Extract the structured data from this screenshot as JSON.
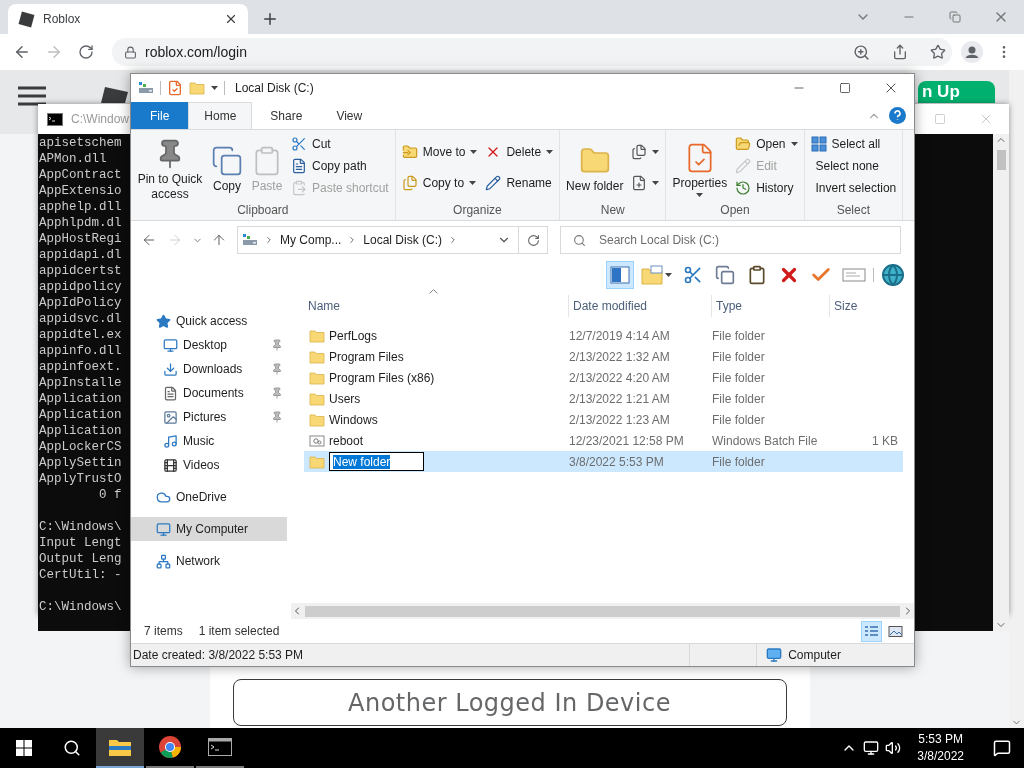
{
  "browser": {
    "tabs": [
      {
        "title": "Roblox",
        "selected": true
      }
    ],
    "url": "roblox.com/login"
  },
  "page": {
    "header_button": "n Up",
    "device_button": "Another Logged In Device"
  },
  "console": {
    "title": "C:\\Window",
    "blocks": [
      [
        "apisetschem",
        "APMon.dll",
        "AppContract",
        "AppExtensio",
        "apphelp.dll",
        "Apphlpdm.dl",
        "AppHostRegi",
        "appidapi.dl",
        "appidcertst",
        "appidpolicy",
        "AppIdPolicy",
        "appidsvc.dl",
        "appidtel.ex",
        "appinfo.dll",
        "appinfoext.",
        "AppInstalle",
        "Application",
        "Application",
        "Application",
        "AppLockerCS",
        "ApplySettin",
        "ApplyTrustO",
        "        0 f"
      ],
      [
        "C:\\Windows\\",
        "Input Lengt",
        "Output Leng",
        "CertUtil: -"
      ],
      [
        "C:\\Windows\\"
      ]
    ]
  },
  "explorer": {
    "title": "Local Disk (C:)",
    "ribbon_tabs": [
      {
        "label": "File",
        "kind": "file",
        "selected": false
      },
      {
        "label": "Home",
        "kind": "tab",
        "selected": true
      },
      {
        "label": "Share",
        "kind": "tab",
        "selected": false
      },
      {
        "label": "View",
        "kind": "tab",
        "selected": false
      }
    ],
    "ribbon_groups": [
      {
        "label": "Clipboard",
        "columns": [
          [
            {
              "label": "Pin to Quick access",
              "kind": "large",
              "disabled": false,
              "dropdown": false
            }
          ],
          [
            {
              "label": "Copy",
              "kind": "large",
              "disabled": false,
              "dropdown": false
            }
          ],
          [
            {
              "label": "Paste",
              "kind": "large",
              "disabled": true,
              "dropdown": false
            }
          ],
          [
            {
              "label": "Cut",
              "kind": "small",
              "disabled": false,
              "dropdown": false
            },
            {
              "label": "Copy path",
              "kind": "small",
              "disabled": false,
              "dropdown": false
            },
            {
              "label": "Paste shortcut",
              "kind": "small",
              "disabled": true,
              "dropdown": false
            }
          ]
        ]
      },
      {
        "label": "Organize",
        "columns": [
          [
            {
              "label": "Move to",
              "kind": "small",
              "disabled": false,
              "dropdown": true
            },
            {
              "label": "Copy to",
              "kind": "small",
              "disabled": false,
              "dropdown": true
            }
          ],
          [
            {
              "label": "Delete",
              "kind": "small",
              "disabled": false,
              "dropdown": true
            },
            {
              "label": "Rename",
              "kind": "small",
              "disabled": false,
              "dropdown": false
            }
          ]
        ]
      },
      {
        "label": "New",
        "columns": [
          [
            {
              "label": "New folder",
              "kind": "large",
              "disabled": false,
              "dropdown": false
            }
          ],
          [
            {
              "kind": "small",
              "disabled": false,
              "dropdown": true
            },
            {
              "kind": "small",
              "disabled": false,
              "dropdown": true
            }
          ]
        ]
      },
      {
        "label": "Open",
        "columns": [
          [
            {
              "label": "Properties",
              "kind": "large",
              "disabled": false,
              "dropdown": true
            }
          ],
          [
            {
              "label": "Open",
              "kind": "small",
              "disabled": false,
              "dropdown": true
            },
            {
              "label": "Edit",
              "kind": "small",
              "disabled": true,
              "dropdown": false
            },
            {
              "label": "History",
              "kind": "small",
              "disabled": false,
              "dropdown": false
            }
          ]
        ]
      },
      {
        "label": "Select",
        "columns": [
          [
            {
              "label": "Select all",
              "kind": "small",
              "disabled": false,
              "dropdown": false
            },
            {
              "label": "Select none",
              "kind": "small",
              "disabled": false,
              "dropdown": false
            },
            {
              "label": "Invert selection",
              "kind": "small",
              "disabled": false,
              "dropdown": false
            }
          ]
        ]
      }
    ],
    "address": {
      "crumbs": [
        "My Comp...",
        "Local Disk (C:)"
      ]
    },
    "search": {
      "placeholder": "Search Local Disk (C:)"
    },
    "toolbar": [
      {
        "pressed": true
      },
      {
        "pressed": false
      },
      {
        "pressed": false
      },
      {
        "pressed": false
      },
      {
        "pressed": false
      },
      {
        "pressed": false
      },
      {
        "pressed": false
      },
      {
        "pressed": false
      },
      {
        "pressed": false
      }
    ],
    "nav": [
      {
        "label": "Quick access",
        "selected": false,
        "pinned": false,
        "children": [
          {
            "label": "Desktop",
            "selected": false,
            "pinned": true
          },
          {
            "label": "Downloads",
            "selected": false,
            "pinned": true
          },
          {
            "label": "Documents",
            "selected": false,
            "pinned": true
          },
          {
            "label": "Pictures",
            "selected": false,
            "pinned": true
          },
          {
            "label": "Music",
            "selected": false,
            "pinned": false
          },
          {
            "label": "Videos",
            "selected": false,
            "pinned": false
          }
        ]
      },
      {
        "label": "OneDrive",
        "selected": false,
        "pinned": false
      },
      {
        "label": "My Computer",
        "selected": true,
        "pinned": false
      },
      {
        "label": "Network",
        "selected": false,
        "pinned": false
      }
    ],
    "columns": [
      "Name",
      "Date modified",
      "Type",
      "Size"
    ],
    "files": [
      {
        "name": "PerfLogs",
        "date": "12/7/2019 4:14 AM",
        "type": "File folder",
        "kind": "folder",
        "selected": false,
        "renaming": false
      },
      {
        "name": "Program Files",
        "date": "2/13/2022 1:32 AM",
        "type": "File folder",
        "kind": "folder",
        "selected": false,
        "renaming": false
      },
      {
        "name": "Program Files (x86)",
        "date": "2/13/2022 4:20 AM",
        "type": "File folder",
        "kind": "folder",
        "selected": false,
        "renaming": false
      },
      {
        "name": "Users",
        "date": "2/13/2022 1:21 AM",
        "type": "File folder",
        "kind": "folder",
        "selected": false,
        "renaming": false
      },
      {
        "name": "Windows",
        "date": "2/13/2022 1:23 AM",
        "type": "File folder",
        "kind": "folder",
        "selected": false,
        "renaming": false
      },
      {
        "name": "reboot",
        "date": "12/23/2021 12:58 PM",
        "type": "Windows Batch File",
        "size": "1 KB",
        "kind": "batch",
        "selected": false,
        "renaming": false
      },
      {
        "name": "New folder",
        "date": "3/8/2022 5:53 PM",
        "type": "File folder",
        "kind": "folder",
        "selected": true,
        "renaming": true
      }
    ],
    "item_count": "7 items",
    "selection_info": "1 item selected",
    "view_buttons": [
      {
        "selected": true
      },
      {
        "selected": false
      }
    ],
    "status": {
      "info": "Date created: 3/8/2022 5:53 PM",
      "location": "Computer"
    }
  },
  "taskbar": {
    "apps": [
      {
        "selected": true
      },
      {
        "selected": false
      },
      {
        "selected": false
      }
    ],
    "time": "5:53 PM",
    "date": "3/8/2022"
  }
}
